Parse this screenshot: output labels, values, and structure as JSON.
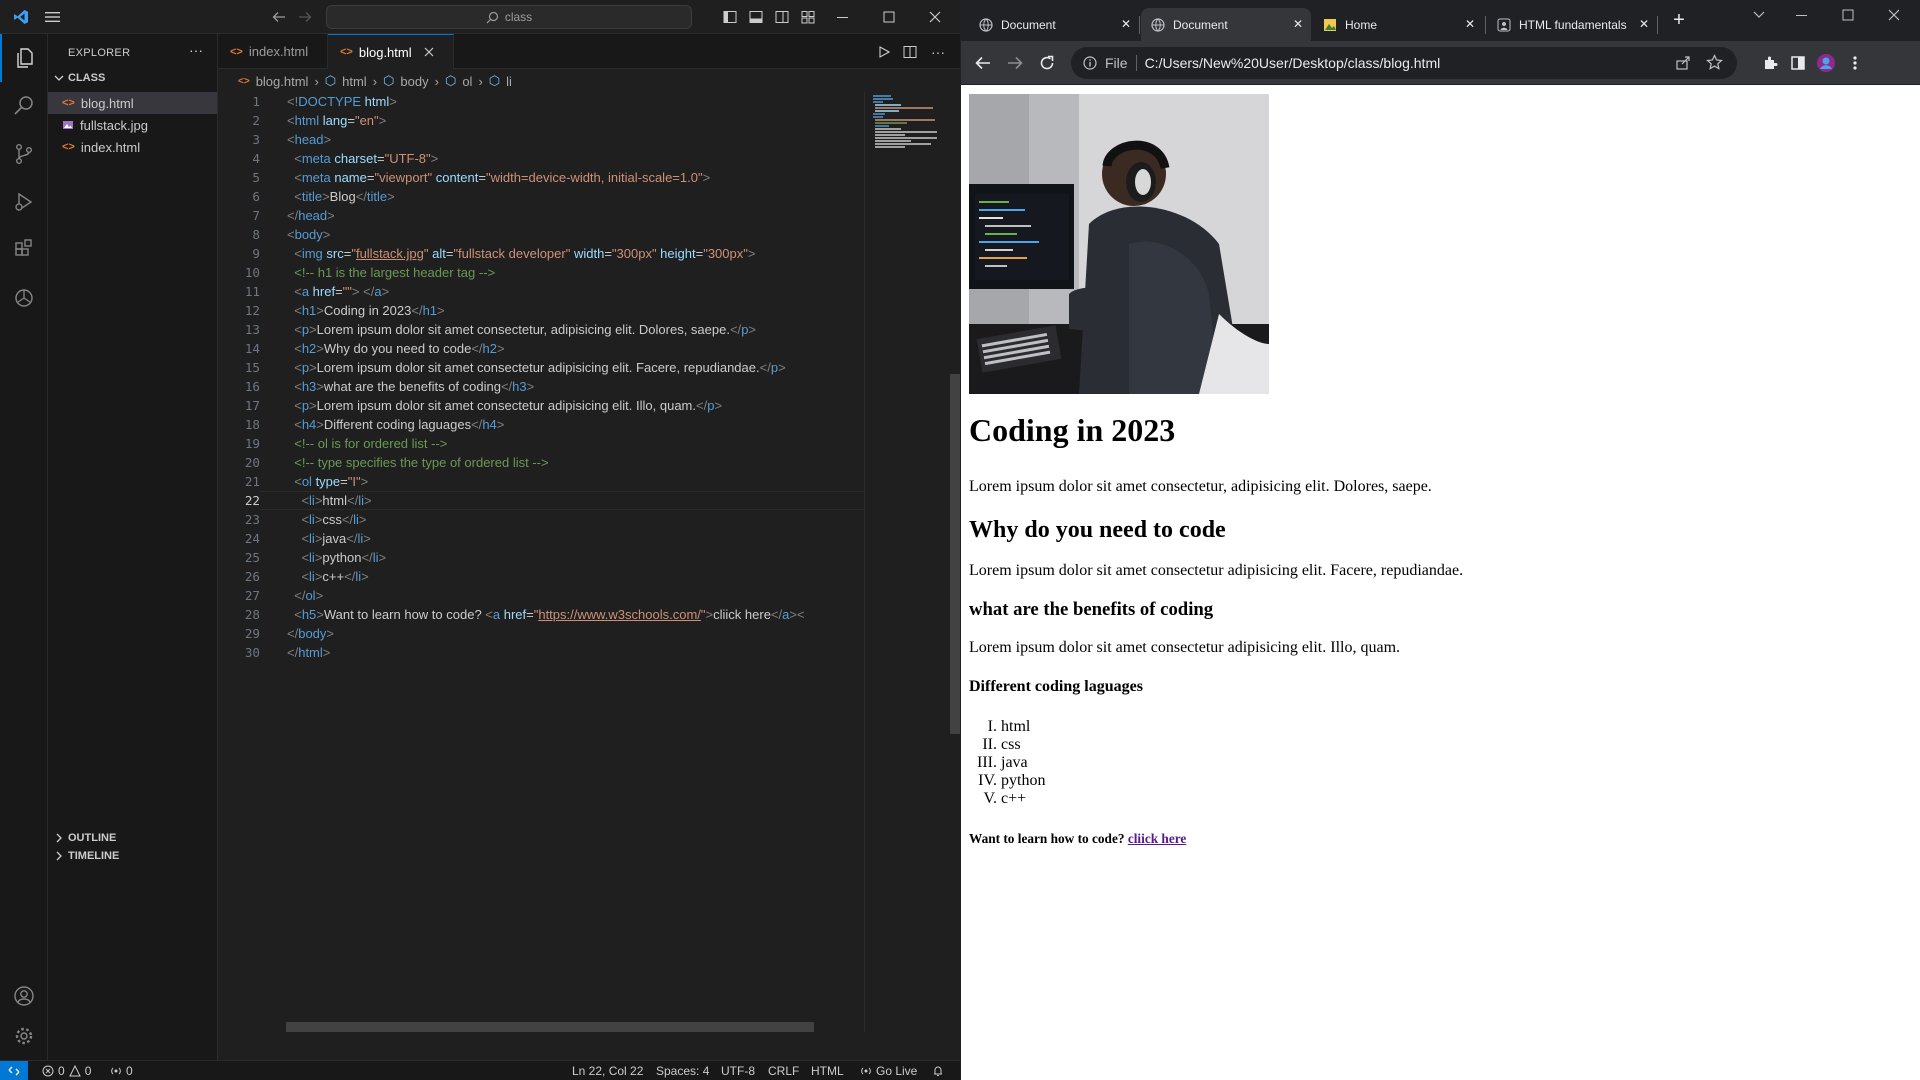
{
  "vscode": {
    "search_text": "class",
    "sidebar": {
      "title": "EXPLORER",
      "folder": "CLASS",
      "files": [
        {
          "name": "blog.html",
          "type": "html"
        },
        {
          "name": "fullstack.jpg",
          "type": "image"
        },
        {
          "name": "index.html",
          "type": "html"
        }
      ],
      "outline": "OUTLINE",
      "timeline": "TIMELINE"
    },
    "tabs": [
      {
        "label": "index.html"
      },
      {
        "label": "blog.html"
      }
    ],
    "breadcrumb": [
      "blog.html",
      "html",
      "body",
      "ol",
      "li"
    ],
    "cursor_line": 22,
    "code_lines": [
      [
        [
          "t",
          "<!"
        ],
        [
          "tg",
          "DOCTYPE"
        ],
        [
          "at",
          " html"
        ],
        [
          "t",
          ">"
        ]
      ],
      [
        [
          "t",
          "<"
        ],
        [
          "tg",
          "html"
        ],
        [
          "at",
          " lang"
        ],
        [
          "tx",
          "="
        ],
        [
          "st",
          "\"en\""
        ],
        [
          "t",
          ">"
        ]
      ],
      [
        [
          "t",
          "<"
        ],
        [
          "tg",
          "head"
        ],
        [
          "t",
          ">"
        ]
      ],
      [
        [
          "tx",
          "  "
        ],
        [
          "t",
          "<"
        ],
        [
          "tg",
          "meta"
        ],
        [
          "at",
          " charset"
        ],
        [
          "tx",
          "="
        ],
        [
          "st",
          "\"UTF-8\""
        ],
        [
          "t",
          ">"
        ]
      ],
      [
        [
          "tx",
          "  "
        ],
        [
          "t",
          "<"
        ],
        [
          "tg",
          "meta"
        ],
        [
          "at",
          " name"
        ],
        [
          "tx",
          "="
        ],
        [
          "st",
          "\"viewport\""
        ],
        [
          "at",
          " content"
        ],
        [
          "tx",
          "="
        ],
        [
          "st",
          "\"width=device-width, initial-scale=1.0\""
        ],
        [
          "t",
          ">"
        ]
      ],
      [
        [
          "tx",
          "  "
        ],
        [
          "t",
          "<"
        ],
        [
          "tg",
          "title"
        ],
        [
          "t",
          ">"
        ],
        [
          "tx",
          "Blog"
        ],
        [
          "t",
          "</"
        ],
        [
          "tg",
          "title"
        ],
        [
          "t",
          ">"
        ]
      ],
      [
        [
          "t",
          "</"
        ],
        [
          "tg",
          "head"
        ],
        [
          "t",
          ">"
        ]
      ],
      [
        [
          "t",
          "<"
        ],
        [
          "tg",
          "body"
        ],
        [
          "t",
          ">"
        ]
      ],
      [
        [
          "tx",
          "  "
        ],
        [
          "t",
          "<"
        ],
        [
          "tg",
          "img"
        ],
        [
          "at",
          " src"
        ],
        [
          "tx",
          "="
        ],
        [
          "st",
          "\""
        ],
        [
          "stu",
          "fullstack.jpg"
        ],
        [
          "st",
          "\""
        ],
        [
          "at",
          " alt"
        ],
        [
          "tx",
          "="
        ],
        [
          "st",
          "\"fullstack developer\""
        ],
        [
          "at",
          " width"
        ],
        [
          "tx",
          "="
        ],
        [
          "st",
          "\"300px\""
        ],
        [
          "at",
          " height"
        ],
        [
          "tx",
          "="
        ],
        [
          "st",
          "\"300px\""
        ],
        [
          "t",
          ">"
        ]
      ],
      [
        [
          "tx",
          "  "
        ],
        [
          "cm",
          "<!-- h1 is the largest header tag -->"
        ]
      ],
      [
        [
          "tx",
          "  "
        ],
        [
          "t",
          "<"
        ],
        [
          "tg",
          "a"
        ],
        [
          "at",
          " href"
        ],
        [
          "tx",
          "="
        ],
        [
          "st",
          "\"\""
        ],
        [
          "t",
          "> </"
        ],
        [
          "tg",
          "a"
        ],
        [
          "t",
          ">"
        ]
      ],
      [
        [
          "tx",
          "  "
        ],
        [
          "t",
          "<"
        ],
        [
          "tg",
          "h1"
        ],
        [
          "t",
          ">"
        ],
        [
          "tx",
          "Coding in 2023"
        ],
        [
          "t",
          "</"
        ],
        [
          "tg",
          "h1"
        ],
        [
          "t",
          ">"
        ]
      ],
      [
        [
          "tx",
          "  "
        ],
        [
          "t",
          "<"
        ],
        [
          "tg",
          "p"
        ],
        [
          "t",
          ">"
        ],
        [
          "tx",
          "Lorem ipsum dolor sit amet consectetur, adipisicing elit. Dolores, saepe."
        ],
        [
          "t",
          "</"
        ],
        [
          "tg",
          "p"
        ],
        [
          "t",
          ">"
        ]
      ],
      [
        [
          "tx",
          "  "
        ],
        [
          "t",
          "<"
        ],
        [
          "tg",
          "h2"
        ],
        [
          "t",
          ">"
        ],
        [
          "tx",
          "Why do you need to code"
        ],
        [
          "t",
          "</"
        ],
        [
          "tg",
          "h2"
        ],
        [
          "t",
          ">"
        ]
      ],
      [
        [
          "tx",
          "  "
        ],
        [
          "t",
          "<"
        ],
        [
          "tg",
          "p"
        ],
        [
          "t",
          ">"
        ],
        [
          "tx",
          "Lorem ipsum dolor sit amet consectetur adipisicing elit. Facere, repudiandae."
        ],
        [
          "t",
          "</"
        ],
        [
          "tg",
          "p"
        ],
        [
          "t",
          ">"
        ]
      ],
      [
        [
          "tx",
          "  "
        ],
        [
          "t",
          "<"
        ],
        [
          "tg",
          "h3"
        ],
        [
          "t",
          ">"
        ],
        [
          "tx",
          "what are the benefits of coding"
        ],
        [
          "t",
          "</"
        ],
        [
          "tg",
          "h3"
        ],
        [
          "t",
          ">"
        ]
      ],
      [
        [
          "tx",
          "  "
        ],
        [
          "t",
          "<"
        ],
        [
          "tg",
          "p"
        ],
        [
          "t",
          ">"
        ],
        [
          "tx",
          "Lorem ipsum dolor sit amet consectetur adipisicing elit. Illo, quam."
        ],
        [
          "t",
          "</"
        ],
        [
          "tg",
          "p"
        ],
        [
          "t",
          ">"
        ]
      ],
      [
        [
          "tx",
          "  "
        ],
        [
          "t",
          "<"
        ],
        [
          "tg",
          "h4"
        ],
        [
          "t",
          ">"
        ],
        [
          "tx",
          "Different coding laguages"
        ],
        [
          "t",
          "</"
        ],
        [
          "tg",
          "h4"
        ],
        [
          "t",
          ">"
        ]
      ],
      [
        [
          "tx",
          "  "
        ],
        [
          "cm",
          "<!-- ol is for ordered list -->"
        ]
      ],
      [
        [
          "tx",
          "  "
        ],
        [
          "cm",
          "<!-- type specifies the type of ordered list -->"
        ]
      ],
      [
        [
          "tx",
          "  "
        ],
        [
          "t",
          "<"
        ],
        [
          "tg",
          "ol"
        ],
        [
          "at",
          " type"
        ],
        [
          "tx",
          "="
        ],
        [
          "st",
          "\"I\""
        ],
        [
          "t",
          ">"
        ]
      ],
      [
        [
          "tx",
          "    "
        ],
        [
          "t",
          "<"
        ],
        [
          "tg",
          "li"
        ],
        [
          "t",
          ">"
        ],
        [
          "tx",
          "html"
        ],
        [
          "t",
          "</"
        ],
        [
          "tg",
          "li"
        ],
        [
          "t",
          ">"
        ]
      ],
      [
        [
          "tx",
          "    "
        ],
        [
          "t",
          "<"
        ],
        [
          "tg",
          "li"
        ],
        [
          "t",
          ">"
        ],
        [
          "tx",
          "css"
        ],
        [
          "t",
          "</"
        ],
        [
          "tg",
          "li"
        ],
        [
          "t",
          ">"
        ]
      ],
      [
        [
          "tx",
          "    "
        ],
        [
          "t",
          "<"
        ],
        [
          "tg",
          "li"
        ],
        [
          "t",
          ">"
        ],
        [
          "tx",
          "java"
        ],
        [
          "t",
          "</"
        ],
        [
          "tg",
          "li"
        ],
        [
          "t",
          ">"
        ]
      ],
      [
        [
          "tx",
          "    "
        ],
        [
          "t",
          "<"
        ],
        [
          "tg",
          "li"
        ],
        [
          "t",
          ">"
        ],
        [
          "tx",
          "python"
        ],
        [
          "t",
          "</"
        ],
        [
          "tg",
          "li"
        ],
        [
          "t",
          ">"
        ]
      ],
      [
        [
          "tx",
          "    "
        ],
        [
          "t",
          "<"
        ],
        [
          "tg",
          "li"
        ],
        [
          "t",
          ">"
        ],
        [
          "tx",
          "c++"
        ],
        [
          "t",
          "</"
        ],
        [
          "tg",
          "li"
        ],
        [
          "t",
          ">"
        ]
      ],
      [
        [
          "tx",
          "  "
        ],
        [
          "t",
          "</"
        ],
        [
          "tg",
          "ol"
        ],
        [
          "t",
          ">"
        ]
      ],
      [
        [
          "tx",
          "  "
        ],
        [
          "t",
          "<"
        ],
        [
          "tg",
          "h5"
        ],
        [
          "t",
          ">"
        ],
        [
          "tx",
          "Want to learn how to code? "
        ],
        [
          "t",
          "<"
        ],
        [
          "tg",
          "a"
        ],
        [
          "at",
          " href"
        ],
        [
          "tx",
          "="
        ],
        [
          "st",
          "\""
        ],
        [
          "stu",
          "https://www.w3schools.com/"
        ],
        [
          "st",
          "\""
        ],
        [
          "t",
          ">"
        ],
        [
          "tx",
          "cliick here"
        ],
        [
          "t",
          "</"
        ],
        [
          "tg",
          "a"
        ],
        [
          "t",
          "><"
        ]
      ],
      [
        [
          "t",
          "</"
        ],
        [
          "tg",
          "body"
        ],
        [
          "t",
          ">"
        ]
      ],
      [
        [
          "t",
          "</"
        ],
        [
          "tg",
          "html"
        ],
        [
          "t",
          ">"
        ]
      ]
    ],
    "status": {
      "errors": "0",
      "warnings": "0",
      "ports": "0",
      "position": "Ln 22, Col 22",
      "spaces": "Spaces: 4",
      "encoding": "UTF-8",
      "eol": "CRLF",
      "language": "HTML",
      "golive": "Go Live"
    }
  },
  "chrome": {
    "tabs": [
      {
        "label": "Document",
        "icon": "globe-icon"
      },
      {
        "label": "Document",
        "icon": "globe-icon"
      },
      {
        "label": "Home",
        "icon": "image-icon"
      },
      {
        "label": "HTML fundamentals",
        "icon": "person-icon"
      }
    ],
    "active_tab": 1,
    "omnibox_scheme": "File",
    "url": "C:/Users/New%20User/Desktop/class/blog.html",
    "page": {
      "h1": "Coding in 2023",
      "p1": "Lorem ipsum dolor sit amet consectetur, adipisicing elit. Dolores, saepe.",
      "h2": "Why do you need to code",
      "p2": "Lorem ipsum dolor sit amet consectetur adipisicing elit. Facere, repudiandae.",
      "h3": "what are the benefits of coding",
      "p3": "Lorem ipsum dolor sit amet consectetur adipisicing elit. Illo, quam.",
      "h4": "Different coding laguages",
      "list_markers": [
        "I.",
        "II.",
        "III.",
        "IV.",
        "V."
      ],
      "list": [
        "html",
        "css",
        "java",
        "python",
        "c++"
      ],
      "h5_text": "Want to learn how to code?",
      "link_text": "cliick here"
    }
  },
  "colors": {
    "vscode_bg": "#1f1f1f",
    "accent": "#0078d4",
    "status_remote": "#0078d4",
    "visited_link": "#551a8b"
  }
}
